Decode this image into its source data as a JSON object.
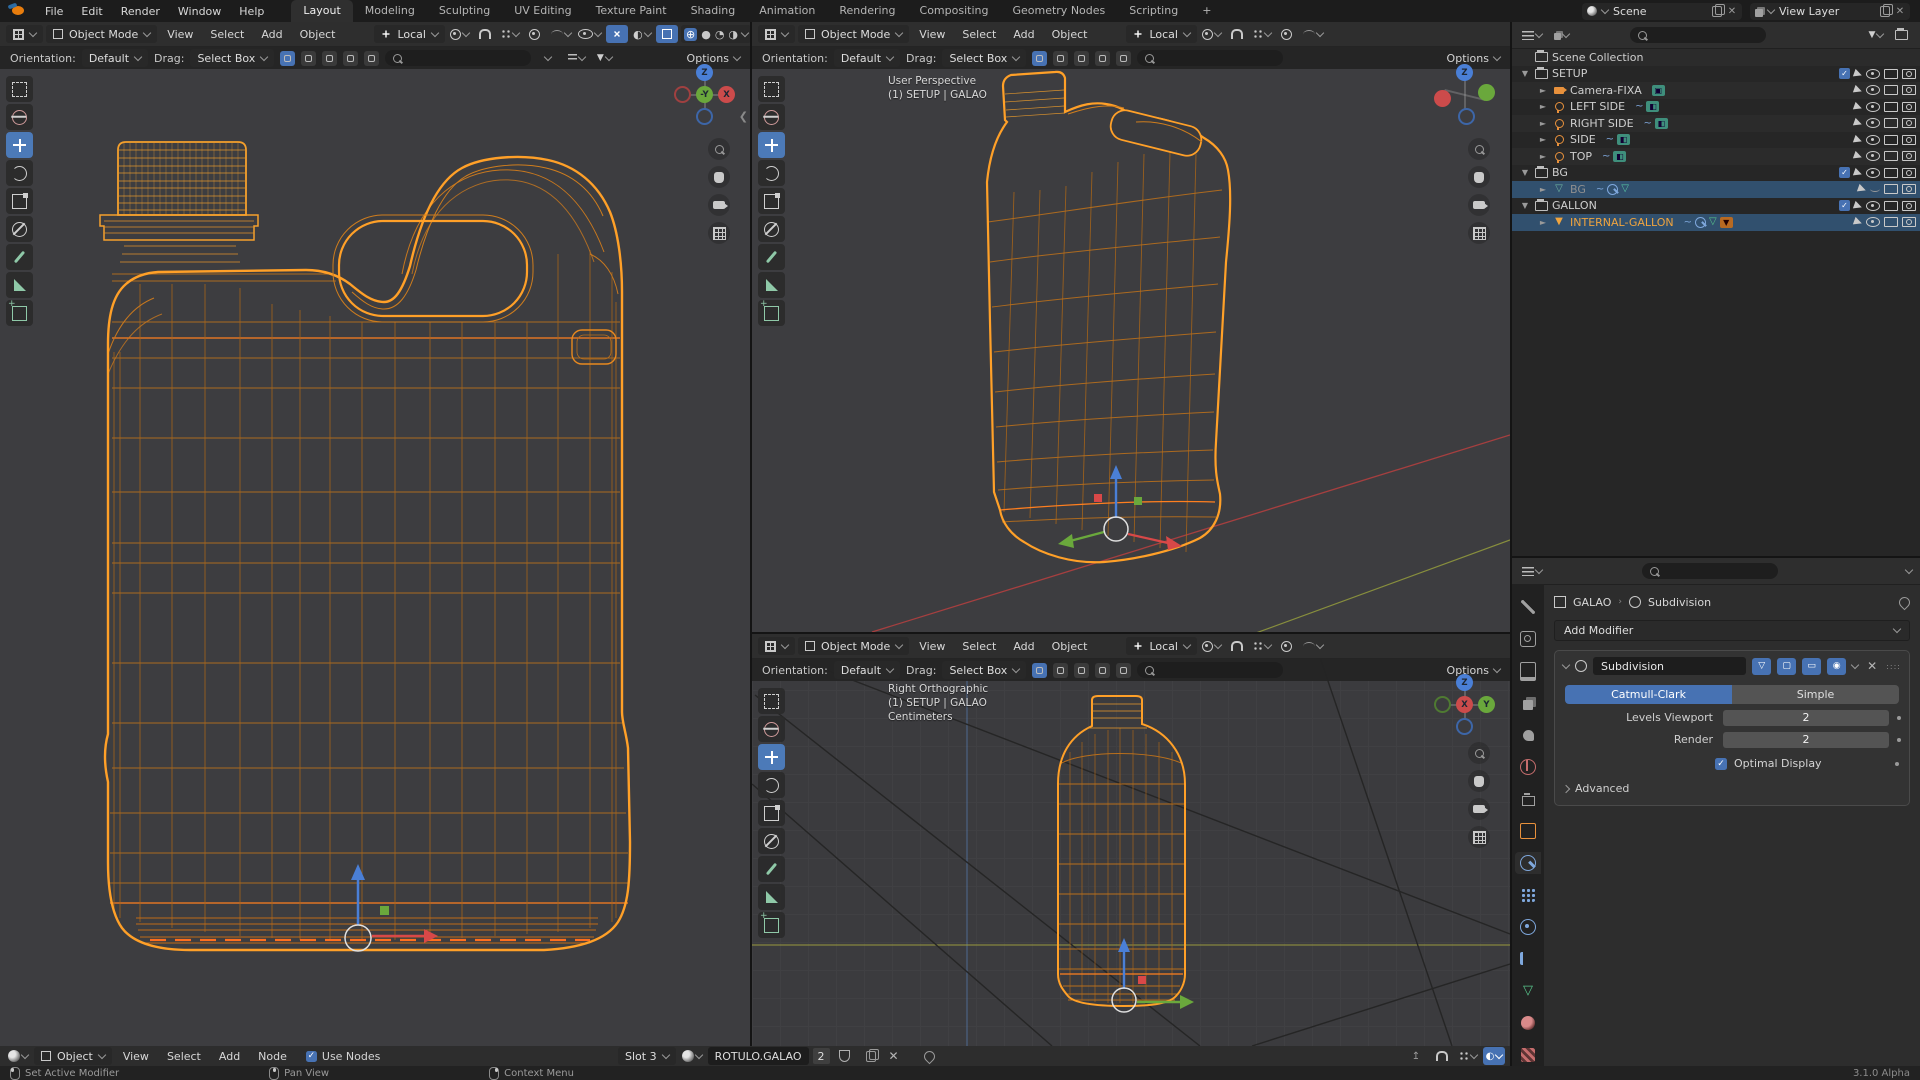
{
  "topbar": {
    "menus": [
      "File",
      "Edit",
      "Render",
      "Window",
      "Help"
    ],
    "tabs": [
      {
        "label": "Layout",
        "active": true
      },
      {
        "label": "Modeling"
      },
      {
        "label": "Sculpting"
      },
      {
        "label": "UV Editing"
      },
      {
        "label": "Texture Paint"
      },
      {
        "label": "Shading"
      },
      {
        "label": "Animation"
      },
      {
        "label": "Rendering"
      },
      {
        "label": "Compositing"
      },
      {
        "label": "Geometry Nodes"
      },
      {
        "label": "Scripting"
      }
    ],
    "new_tab_label": "+",
    "scene_label": "Scene",
    "view_layer_label": "View Layer"
  },
  "viewport": {
    "mode": "Object Mode",
    "menu_view": "View",
    "menu_select": "Select",
    "menu_add": "Add",
    "menu_object": "Object",
    "orientation": "Local",
    "options_label": "Options",
    "tools": {
      "orientation_label": "Orientation:",
      "orientation_value": "Default",
      "drag_label": "Drag:",
      "drag_value": "Select Box"
    }
  },
  "overlays": {
    "top_right": {
      "line1": "User Perspective",
      "line2": "(1) SETUP | GALAO"
    },
    "bottom_right": {
      "line1": "Right Orthographic",
      "line2": "(1) SETUP | GALAO",
      "line3": "Centimeters"
    }
  },
  "gizmo": {
    "z": "Z",
    "x": "X",
    "neg_y": "-Y",
    "y": "Y"
  },
  "outliner": {
    "rows": {
      "scene_collection": "Scene Collection",
      "setup": "SETUP",
      "camera": "Camera-FIXA",
      "left_side": "LEFT SIDE",
      "right_side": "RIGHT SIDE",
      "side": "SIDE",
      "top": "TOP",
      "bg_col": "BG",
      "bg_obj": "BG",
      "gallon": "GALLON",
      "internal": "INTERNAL-GALLON"
    }
  },
  "properties": {
    "breadcrumb_object": "GALAO",
    "breadcrumb_modifier": "Subdivision",
    "add_modifier": "Add Modifier",
    "modifier": {
      "name": "Subdivision",
      "type_left": "Catmull-Clark",
      "type_right": "Simple",
      "levels_label": "Levels Viewport",
      "levels_value": "2",
      "render_label": "Render",
      "render_value": "2",
      "optimal_label": "Optimal Display",
      "advanced_label": "Advanced"
    }
  },
  "shader": {
    "object": "Object",
    "menu_view": "View",
    "menu_select": "Select",
    "menu_add": "Add",
    "menu_node": "Node",
    "use_nodes": "Use Nodes",
    "slot": "Slot 3",
    "material": "ROTULO.GALAO",
    "users": "2"
  },
  "status": {
    "hint1": "Set Active Modifier",
    "hint2": "Pan View",
    "hint3": "Context Menu",
    "version": "3.1.0 Alpha"
  },
  "colors": {
    "accent": "#4772b3",
    "selection": "#31506e",
    "wire_selected": "#ffa028",
    "active_text": "#f0a43e",
    "axis_x": "#e05252",
    "axis_y": "#6aa83c",
    "axis_z": "#4a7fd6"
  }
}
